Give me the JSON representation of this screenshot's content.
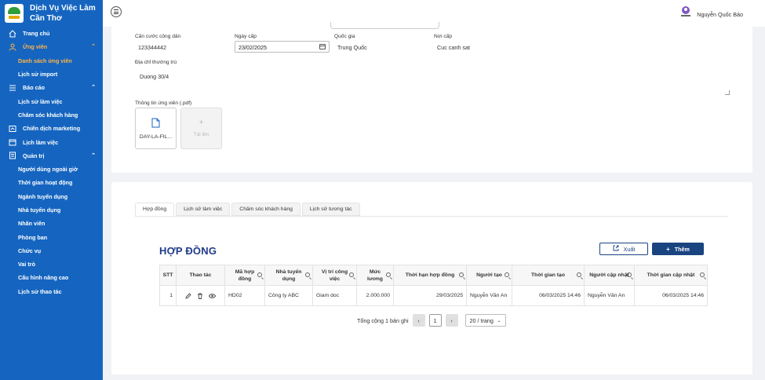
{
  "brand": {
    "line1": "Dịch Vụ Việc Làm",
    "line2": "Cần Thơ"
  },
  "sidebar": {
    "items": [
      {
        "label": "Trang chủ",
        "icon": "home-icon"
      },
      {
        "label": "Ứng viên",
        "icon": "users-icon"
      },
      {
        "label": "Danh sách ứng viên"
      },
      {
        "label": "Lịch sử import"
      },
      {
        "label": "Báo cáo",
        "icon": "list-icon"
      },
      {
        "label": "Lịch sử làm việc"
      },
      {
        "label": "Chăm sóc khách hàng"
      },
      {
        "label": "Chiến dịch marketing",
        "icon": "campaign-icon"
      },
      {
        "label": "Lịch làm việc",
        "icon": "calendar-icon"
      },
      {
        "label": "Quản trị",
        "icon": "admin-icon"
      },
      {
        "label": "Người dùng ngoài giờ"
      },
      {
        "label": "Thời gian hoạt động"
      },
      {
        "label": "Ngành tuyển dụng"
      },
      {
        "label": "Nhà tuyển dụng"
      },
      {
        "label": "Nhân viên"
      },
      {
        "label": "Phòng ban"
      },
      {
        "label": "Chức vụ"
      },
      {
        "label": "Vai trò"
      },
      {
        "label": "Cấu hình nâng cao"
      },
      {
        "label": "Lịch sử thao tác"
      }
    ]
  },
  "header": {
    "user_name": "Nguyễn Quốc Bảo"
  },
  "info": {
    "id_label": "Căn cước công dân",
    "id_value": "123344442",
    "date_label": "Ngày cấp",
    "date_value": "23/02/2025",
    "country_label": "Quốc gia",
    "country_value": "Trung Quốc",
    "place_label": "Nơi cấp",
    "place_value": "Cuc canh sat",
    "address_label": "Địa chỉ thường trú",
    "address_value": "Duong 30/4",
    "file_label": "Thông tin ứng viên (.pdf)",
    "file_name": "DAY-LA-FIL...",
    "upload_label": "Tải lên"
  },
  "tabs": [
    "Hợp đồng",
    "Lịch sử làm việc",
    "Chăm sóc khách hàng",
    "Lịch sử tương tác"
  ],
  "contract": {
    "title": "HỢP ĐỒNG",
    "export_label": "Xuất",
    "add_label": "Thêm",
    "columns": [
      "STT",
      "Thao tác",
      "Mã hợp đồng",
      "Nhà tuyển dụng",
      "Vị trí công việc",
      "Mức lương",
      "Thời hạn hợp đồng",
      "Người tạo",
      "Thời gian tạo",
      "Người cập nhật",
      "Thời gian cập nhật"
    ],
    "rows": [
      {
        "stt": "1",
        "code": "HD02",
        "employer": "Công ty ABC",
        "position": "Giam doc",
        "salary": "2.000.000",
        "term": "29/03/2025",
        "creator": "Nguyễn Văn An",
        "created": "06/03/2025 14:46",
        "updater": "Nguyễn Văn An",
        "updated": "06/03/2025 14:46"
      }
    ]
  },
  "pagination": {
    "total": "Tổng cộng 1 bản ghi",
    "page": "1",
    "page_size": "20 / trang"
  }
}
